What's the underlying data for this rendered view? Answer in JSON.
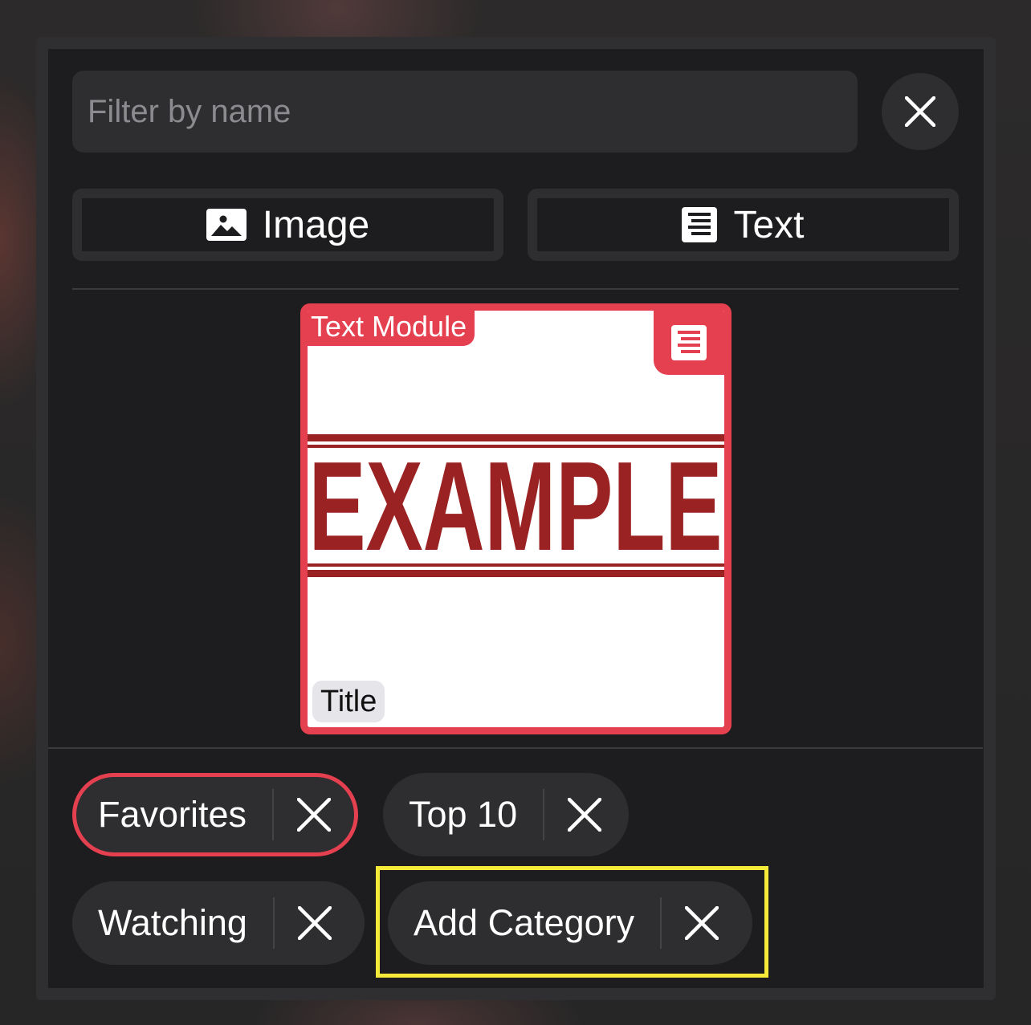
{
  "search": {
    "placeholder": "Filter by name",
    "value": ""
  },
  "buttons": {
    "clear_icon": "close-icon",
    "image_label": "Image",
    "image_icon": "image-icon",
    "text_label": "Text",
    "text_icon": "text-lines-icon"
  },
  "module_card": {
    "label": "Text Module",
    "corner_icon": "text-lines-icon",
    "image_text": "EXAMPLE",
    "title": "Title",
    "accent_color": "#e5404f",
    "stamp_color": "#9b2222"
  },
  "categories": [
    {
      "label": "Favorites",
      "selected": true
    },
    {
      "label": "Top 10",
      "selected": false
    },
    {
      "label": "Watching",
      "selected": false
    },
    {
      "label": "Add Category",
      "selected": false,
      "highlighted": true
    }
  ],
  "colors": {
    "panel_bg": "#1d1d1f",
    "control_bg": "#2e2e30",
    "selected_border": "#e5404f",
    "highlight_border": "#f5ea3a"
  }
}
